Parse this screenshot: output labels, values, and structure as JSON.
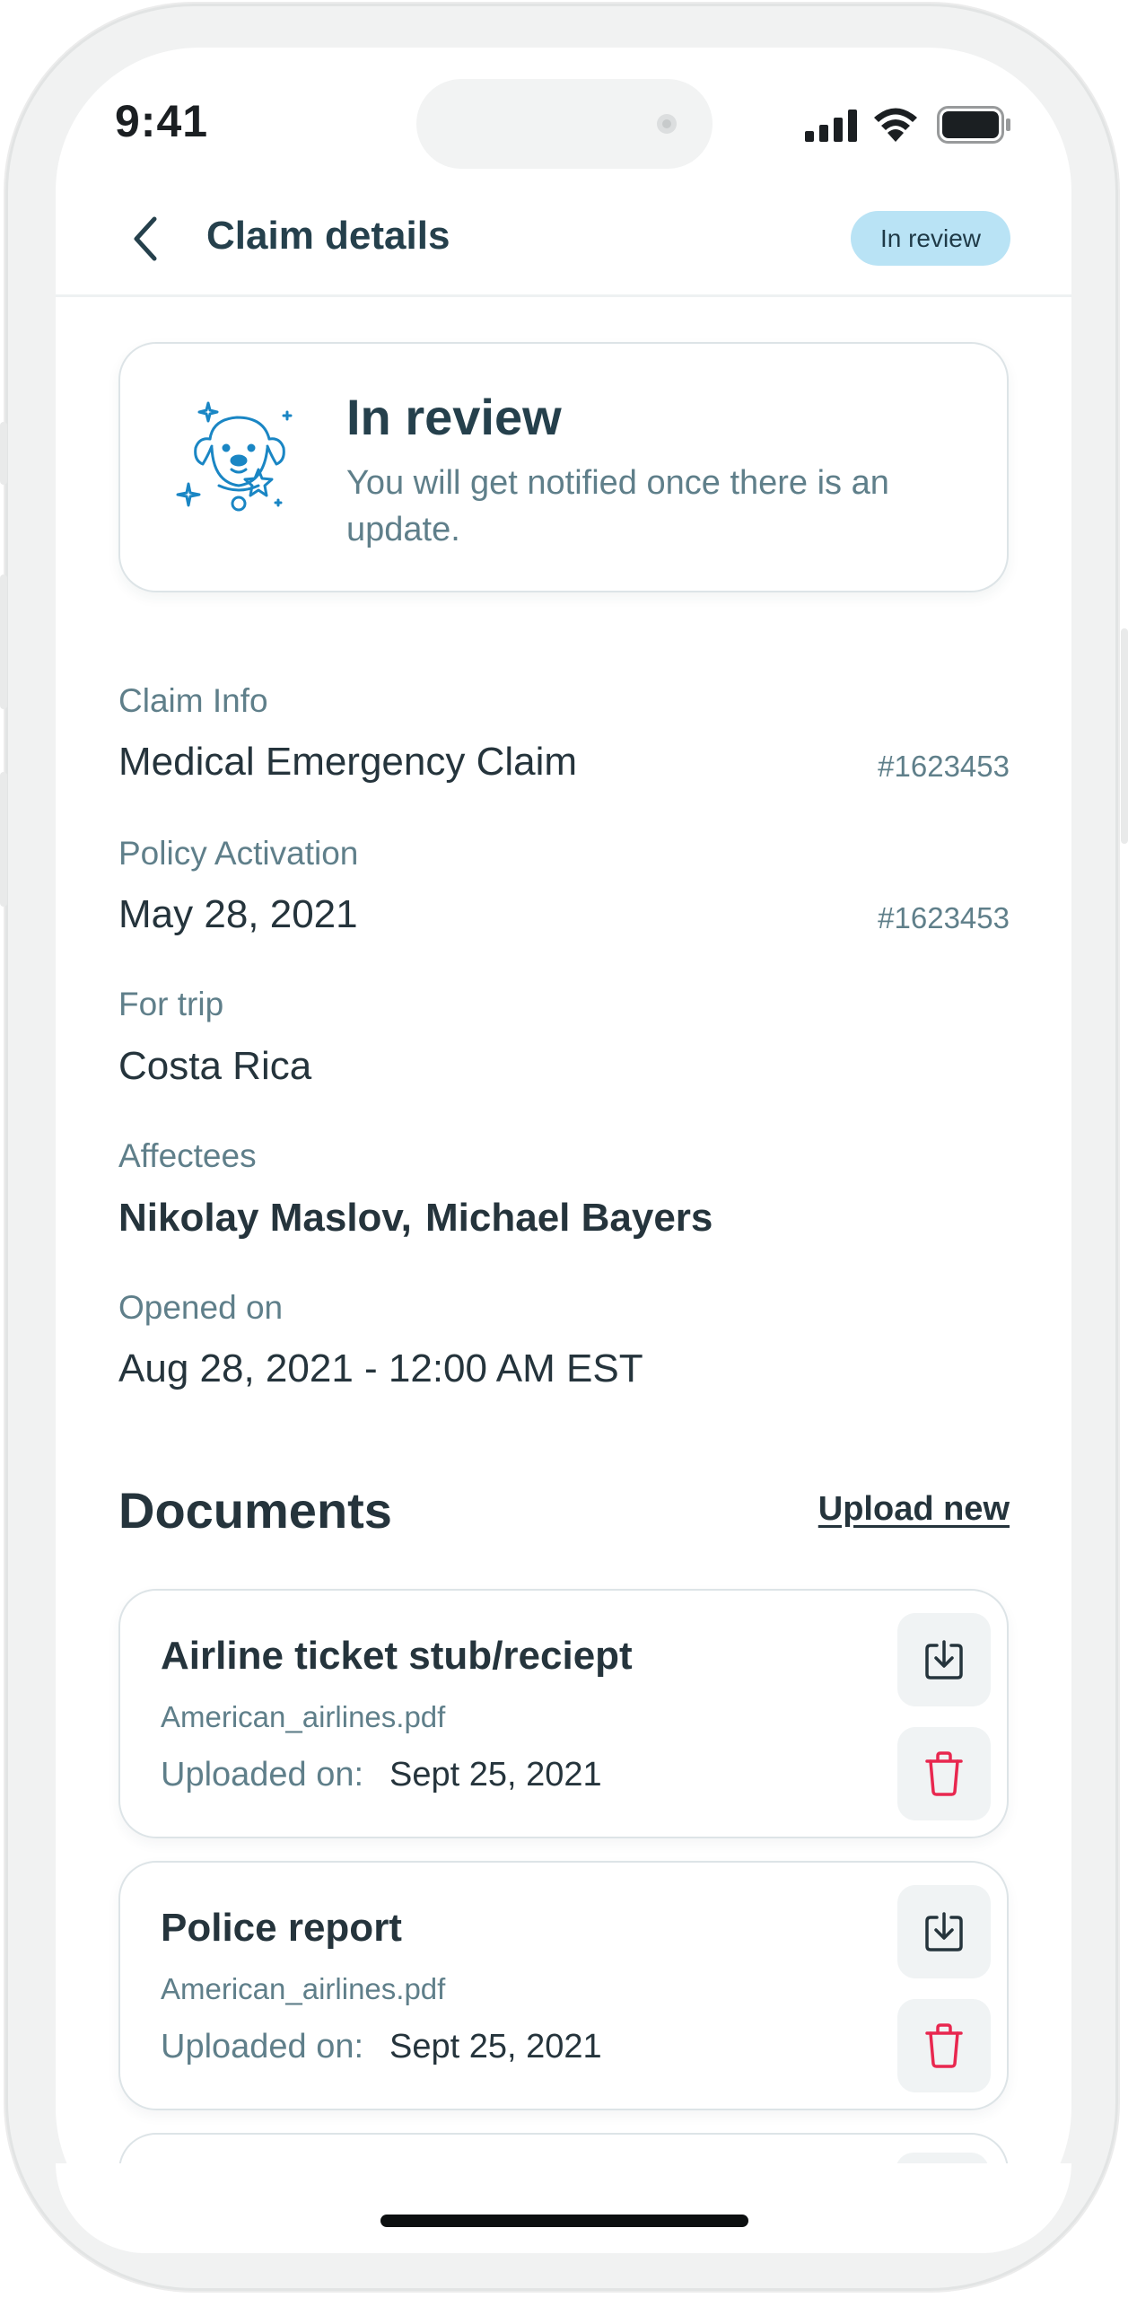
{
  "status_bar": {
    "time": "9:41"
  },
  "header": {
    "title": "Claim details",
    "status_badge": "In review"
  },
  "review_card": {
    "title": "In review",
    "subtitle": "You will get notified once there is an update."
  },
  "claim_info": {
    "label": "Claim Info",
    "value": "Medical Emergency Claim",
    "ref": "#1623453"
  },
  "policy_activation": {
    "label": "Policy Activation",
    "value": "May 28, 2021",
    "ref": "#1623453"
  },
  "trip": {
    "label": "For trip",
    "value": "Costa Rica"
  },
  "affectees": {
    "label": "Affectees",
    "names": [
      "Nikolay Maslov,",
      "Michael Bayers"
    ]
  },
  "opened": {
    "label": "Opened on",
    "value": "Aug 28, 2021 - 12:00 AM EST"
  },
  "documents": {
    "title": "Documents",
    "upload_label": "Upload new",
    "uploaded_label": "Uploaded on:",
    "items": [
      {
        "title": "Airline ticket stub/reciept",
        "file": "American_airlines.pdf",
        "date": "Sept 25, 2021"
      },
      {
        "title": "Police report",
        "file": "American_airlines.pdf",
        "date": "Sept 25, 2021"
      }
    ]
  },
  "colors": {
    "badge_bg": "#b9e3f5",
    "mascot_blue": "#1a86c4",
    "delete_red": "#e8274f",
    "muted_text": "#5f7f8a",
    "heading_text": "#25343c"
  },
  "icons": [
    "back-chevron-icon",
    "signal-icon",
    "wifi-icon",
    "battery-icon",
    "dog-mascot-icon",
    "download-icon",
    "trash-icon"
  ]
}
